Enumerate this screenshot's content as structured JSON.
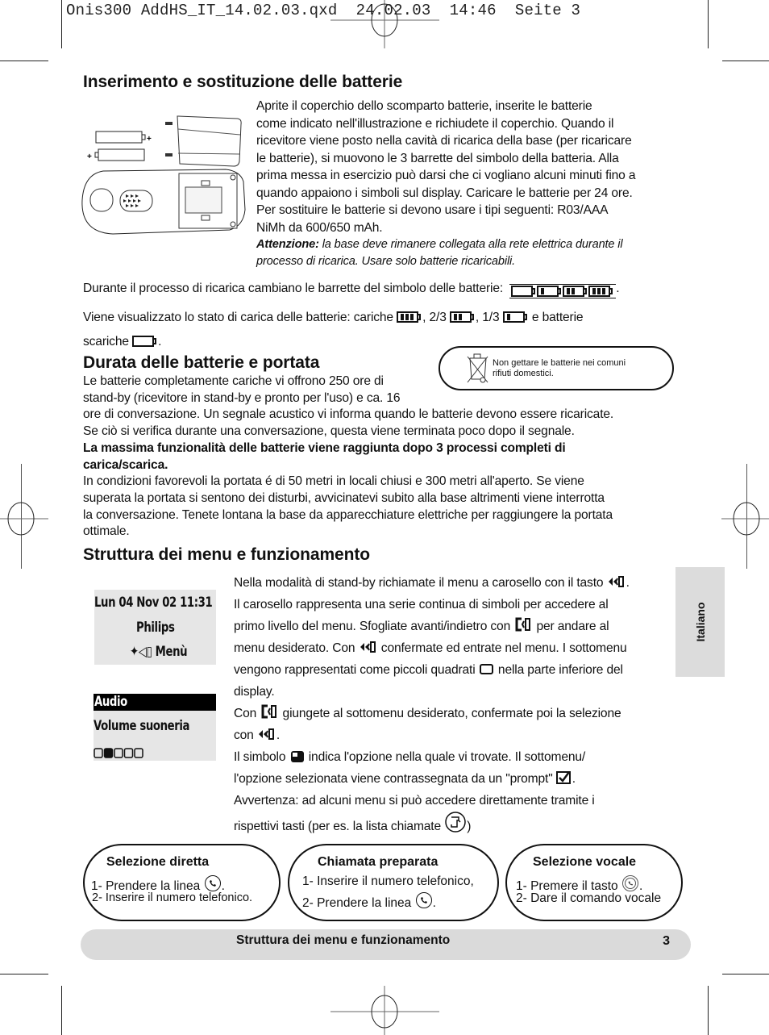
{
  "slug": "Onis300 AddHS_IT_14.02.03.qxd  24.02.03  14:46  Seite 3",
  "section1": {
    "heading": "Inserimento e sostituzione delle batterie",
    "paragraph_lines": [
      "Aprite il coperchio dello scomparto batterie, inserite le batterie",
      "come indicato nell'illustrazione e richiudete il coperchio. Quando il",
      "ricevitore viene posto nella cavità di ricarica della base (per ricaricare",
      "le batterie), si muovono le 3 barrette del simbolo della batteria. Alla",
      "prima messa in esercizio può darsi che ci vogliano alcuni minuti fino a",
      "quando appaiono i simboli sul display. Caricare le batterie per 24 ore.",
      "Per sostituire le batterie si devono usare i tipi seguenti: R03/AAA",
      "NiMh da 600/650 mAh."
    ],
    "attention_label": "Attenzione:",
    "attention_line1": " la base deve rimanere collegata alla rete elettrica durante il",
    "attention_line2": "processo di ricarica. Usare solo batterie ricaricabili.",
    "charging_text": "Durante il processo di ricarica cambiano le barrette del simbolo delle batterie:",
    "charging_suffix": ".",
    "status_text_1": "Viene visualizzato lo stato di carica delle batterie: cariche",
    "status_23": ", 2/3",
    "status_13": ", 1/3",
    "status_empty_prefix": "e batterie",
    "status_text_2": "scariche",
    "status_suffix": ".",
    "battery_states": [
      {
        "label": "cariche",
        "bars": 3
      },
      {
        "label": "2/3",
        "bars": 2
      },
      {
        "label": "1/3",
        "bars": 1
      },
      {
        "label": "scariche",
        "bars": 0
      }
    ]
  },
  "notice": {
    "icon": "crossed-out-bin-icon",
    "line1": "Non gettare le batterie nei comuni",
    "line2": "rifiuti domestici."
  },
  "section2": {
    "heading": "Durata delle batterie e portata",
    "lines_narrow": [
      "Le batterie completamente cariche vi offrono 250 ore di",
      "stand-by (ricevitore in stand-by e pronto per l'uso) e ca. 16"
    ],
    "lines_wide": [
      "ore di conversazione. Un segnale acustico vi informa quando le batterie devono essere ricaricate.",
      "Se ciò si verifica durante una conversazione, questa viene terminata poco dopo il segnale."
    ],
    "bold_lines": [
      "La massima funzionalità delle batterie viene raggiunta dopo 3 processi completi di",
      "carica/scarica."
    ],
    "range_lines": [
      "In condizioni favorevoli la portata é di 50 metri in locali chiusi e 300 metri all'aperto. Se viene",
      "superata la portata si sentono dei disturbi, avvicinatevi subito alla base altrimenti viene interrotta",
      "la conversazione. Tenete lontana la base da apparecchiature elettriche per raggiungere la portata",
      "ottimale."
    ]
  },
  "section3": {
    "heading": "Struttura dei menu e funzionamento",
    "lcd1": {
      "row1": "Lun 04 Nov 02   11:31",
      "row2": "Philips",
      "row3": "Menù"
    },
    "lcd2": {
      "title": "Audio",
      "row2": "Volume suoneria",
      "level": 2,
      "levels_total": 5
    },
    "lines": [
      {
        "pre": "Nella modalità di stand-by richiamate il menu a carosello con il tasto",
        "icon": "menu-key",
        "post": "."
      },
      {
        "pre": "Il carosello rappresenta una serie continua di simboli per accedere al"
      },
      {
        "pre": "primo livello del menu. Sfogliate avanti/indietro con",
        "icon": "scroll-key",
        "post": " per andare al"
      },
      {
        "pre": "menu desiderato. Con",
        "icon": "menu-key",
        "post": " confermate ed entrate nel menu. I sottomenu"
      },
      {
        "pre": "vengono rappresentati come piccoli quadrati",
        "icon": "empty-square",
        "post": " nella parte inferiore del"
      },
      {
        "pre": "display."
      },
      {
        "pre": "Con",
        "icon": "scroll-key",
        "post": " giungete al sottomenu desiderato, confermate poi la selezione"
      },
      {
        "pre": "con",
        "icon": "menu-key",
        "post": "."
      },
      {
        "pre": "Il simbolo",
        "icon": "filled-square",
        "post": " indica l'opzione nella quale vi trovate. Il sottomenu/"
      },
      {
        "pre": "l'opzione selezionata viene contrassegnata da un \"prompt\"",
        "icon": "checkmark",
        "post": "."
      },
      {
        "pre": "Avvertenza: ad alcuni menu si può accedere direttamente tramite i"
      },
      {
        "pre": "rispettivi tasti (per es. la lista chiamate",
        "icon": "call-list-key",
        "post": ")"
      }
    ]
  },
  "side_tab": {
    "label": "Italiano"
  },
  "pills": [
    {
      "title": "Selezione diretta",
      "line1": "1- Prendere la linea",
      "line1_suffix": ".",
      "line2": "2- Inserire il numero telefonico."
    },
    {
      "title": "Chiamata preparata",
      "line1": "1- Inserire il numero telefonico,",
      "line2": "2- Prendere la linea",
      "line2_suffix": "."
    },
    {
      "title": "Selezione vocale",
      "line1": "1- Premere il tasto",
      "line1_suffix": ".",
      "line2": "2- Dare il comando vocale"
    }
  ],
  "footer": {
    "title": "Struttura dei menu e funzionamento",
    "page": "3"
  }
}
